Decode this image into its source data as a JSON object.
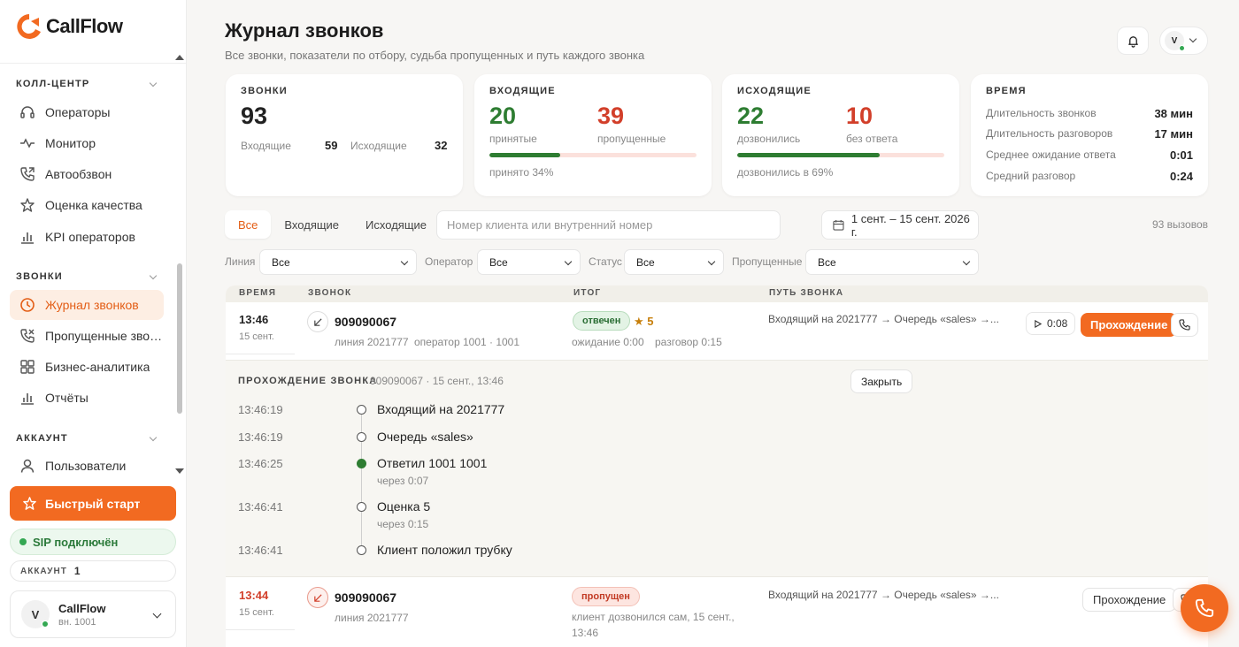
{
  "app": {
    "name": "CallFlow"
  },
  "sidebar": {
    "sections": [
      {
        "title": "КОЛЛ-ЦЕНТР",
        "items": [
          "Операторы",
          "Монитор",
          "Автообзвон",
          "Оценка качества",
          "KPI операторов"
        ]
      },
      {
        "title": "ЗВОНКИ",
        "items": [
          "Журнал звонков",
          "Пропущенные звонки",
          "Бизнес-аналитика",
          "Отчёты"
        ]
      },
      {
        "title": "АККАУНТ",
        "items": [
          "Пользователи"
        ]
      }
    ],
    "quick_start": "Быстрый старт",
    "sip_status": "SIP подключён",
    "account_label": "АККАУНТ",
    "account_number": "1",
    "user": {
      "initial": "V",
      "name": "CallFlow",
      "ext": "вн. 1001"
    }
  },
  "header": {
    "title": "Журнал звонков",
    "subtitle": "Все звонки, показатели по отбору, судьба пропущенных и путь каждого звонка",
    "user_initial": "V"
  },
  "stats": {
    "calls": {
      "title": "ЗВОНКИ",
      "total": "93",
      "in_label": "Входящие",
      "in_value": "59",
      "out_label": "Исходящие",
      "out_value": "32"
    },
    "incoming": {
      "title": "ВХОДЯЩИЕ",
      "accepted": "20",
      "accepted_label": "принятые",
      "missed": "39",
      "missed_label": "пропущенные",
      "ratio": 0.34,
      "note": "принято 34%"
    },
    "outgoing": {
      "title": "ИСХОДЯЩИЕ",
      "reached": "22",
      "reached_label": "дозвонились",
      "noanswer": "10",
      "noanswer_label": "без ответа",
      "ratio": 0.69,
      "note": "дозвонились в 69%"
    },
    "time": {
      "title": "ВРЕМЯ",
      "rows": [
        {
          "label": "Длительность звонков",
          "value": "38 мин"
        },
        {
          "label": "Длительность разговоров",
          "value": "17 мин"
        },
        {
          "label": "Среднее ожидание ответа",
          "value": "0:01"
        },
        {
          "label": "Средний разговор",
          "value": "0:24"
        }
      ]
    }
  },
  "filters": {
    "tabs": [
      "Все",
      "Входящие",
      "Исходящие"
    ],
    "active_tab": "Все",
    "search_placeholder": "Номер клиента или внутренний номер",
    "date_range": "1 сент. – 15 сент. 2026 г.",
    "count": "93 вызовов",
    "selects": [
      {
        "label": "Линия",
        "value": "Все"
      },
      {
        "label": "Оператор",
        "value": "Все"
      },
      {
        "label": "Статус",
        "value": "Все"
      },
      {
        "label": "Пропущенные",
        "value": "Все"
      }
    ]
  },
  "table": {
    "headers": {
      "time": "ВРЕМЯ",
      "call": "ЗВОНОК",
      "result": "ИТОГ",
      "path": "ПУТЬ ЗВОНКА"
    },
    "rows": [
      {
        "time": "13:46",
        "date": "15 сент.",
        "number": "909090067",
        "line": "линия 2021777",
        "operator": "оператор 1001 · 1001",
        "status": "отвечен",
        "rating": "★ 5",
        "wait": "ожидание 0:00",
        "talk": "разговор 0:15",
        "path": "Входящий на 2021777 → Очередь «sales» →...",
        "duration": "0:08",
        "route_btn": "Прохождение"
      },
      {
        "time": "13:44",
        "date": "15 сент.",
        "number": "909090067",
        "line": "линия 2021777",
        "status": "пропущен",
        "note_line1": "клиент дозвонился сам, 15 сент.,",
        "note_line2": "13:46",
        "path": "Входящий на 2021777 → Очередь «sales» →...",
        "route_btn": "Прохождение"
      }
    ]
  },
  "detail": {
    "title": "ПРОХОЖДЕНИЕ ЗВОНКА",
    "meta": "909090067 · 15 сент., 13:46",
    "close": "Закрыть",
    "events": [
      {
        "time": "13:46:19",
        "text": "Входящий на 2021777",
        "sub": ""
      },
      {
        "time": "13:46:19",
        "text": "Очередь «sales»",
        "sub": ""
      },
      {
        "time": "13:46:25",
        "text": "Ответил 1001 1001",
        "sub": "через 0:07"
      },
      {
        "time": "13:46:41",
        "text": "Оценка 5",
        "sub": "через 0:15"
      },
      {
        "time": "13:46:41",
        "text": "Клиент положил трубку",
        "sub": ""
      }
    ]
  },
  "colors": {
    "accent": "#f26a21",
    "green": "#2e7d32",
    "red": "#d23f2a"
  }
}
